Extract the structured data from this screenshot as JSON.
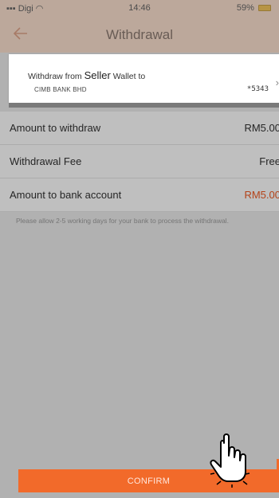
{
  "status_bar": {
    "carrier": "Digi",
    "time": "14:46",
    "battery": "59%"
  },
  "nav": {
    "title": "Withdrawal",
    "back_icon": "arrow-left-icon"
  },
  "bank_card": {
    "withdraw_from_prefix": "Withdraw from",
    "wallet_name": "Seller",
    "withdraw_from_suffix": "Wallet to",
    "bank_name": "CIMB BANK BHD",
    "account_masked": "*5343",
    "chevron_icon": "chevron-right-icon"
  },
  "rows": [
    {
      "label": "Amount to withdraw",
      "value": "RM5.00"
    },
    {
      "label": "Withdrawal Fee",
      "value": "Free"
    },
    {
      "label": "Amount to bank account",
      "value": "RM5.00"
    }
  ],
  "note": "Please allow 2-5 working days for your bank to process the withdrawal.",
  "confirm_button": "CONFIRM",
  "colors": {
    "accent": "#f26a2a",
    "highlight_value": "#f05a22",
    "dim_overlay": "rgba(0,0,0,0.25)"
  },
  "icons": [
    "signal-icon",
    "wifi-icon",
    "battery-icon",
    "hand-pointer-icon"
  ]
}
